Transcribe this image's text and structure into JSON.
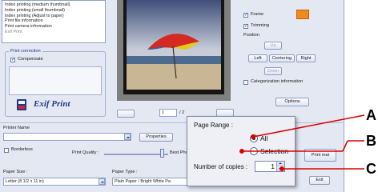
{
  "layout_list": {
    "items": [
      "Index printing (medium thumbnail)",
      "Index printing (small thumbnail)",
      "Index printing (Adjust to paper)",
      "Print file information",
      "Print camera information",
      "Exif Print"
    ]
  },
  "print_correction": {
    "title": "Print correction",
    "compensate_label": "Compensate",
    "exif_logo_text": "Exif Print"
  },
  "right_panel": {
    "frame_label": "Frame",
    "trimming_label": "Trimming",
    "position_label": "Position",
    "up_label": "Up",
    "left_label": "Left",
    "centering_label": "Centering",
    "right_label": "Right",
    "down_label": "Down",
    "categorization_label": "Categorization information",
    "options_label": "Options",
    "frame_color": "#f08a1c"
  },
  "navigator": {
    "page_value": "1",
    "page_total": "/ 2"
  },
  "printer": {
    "printer_name_label": "Printer Name",
    "properties_label": "Properties",
    "borderless_label": "Borderless",
    "print_quality_label": "Print Quality :",
    "best_label": "Best Phot",
    "paper_size_label": "Paper Size :",
    "paper_size_value": "Letter (8 1/2 x 11 in)",
    "paper_type_label": "Paper Type :",
    "paper_type_value": "Plain Paper / Bright White Pa"
  },
  "actions": {
    "print_label": "Print mat",
    "exit_label": "Exit"
  },
  "popup": {
    "page_range_label": "Page Range :",
    "all_label": "All",
    "selection_label": "Selection",
    "copies_label": "Number of copies :",
    "copies_value": "1"
  },
  "callouts": {
    "a": "A",
    "b": "B",
    "c": "C",
    "line_color": "#d90000"
  }
}
